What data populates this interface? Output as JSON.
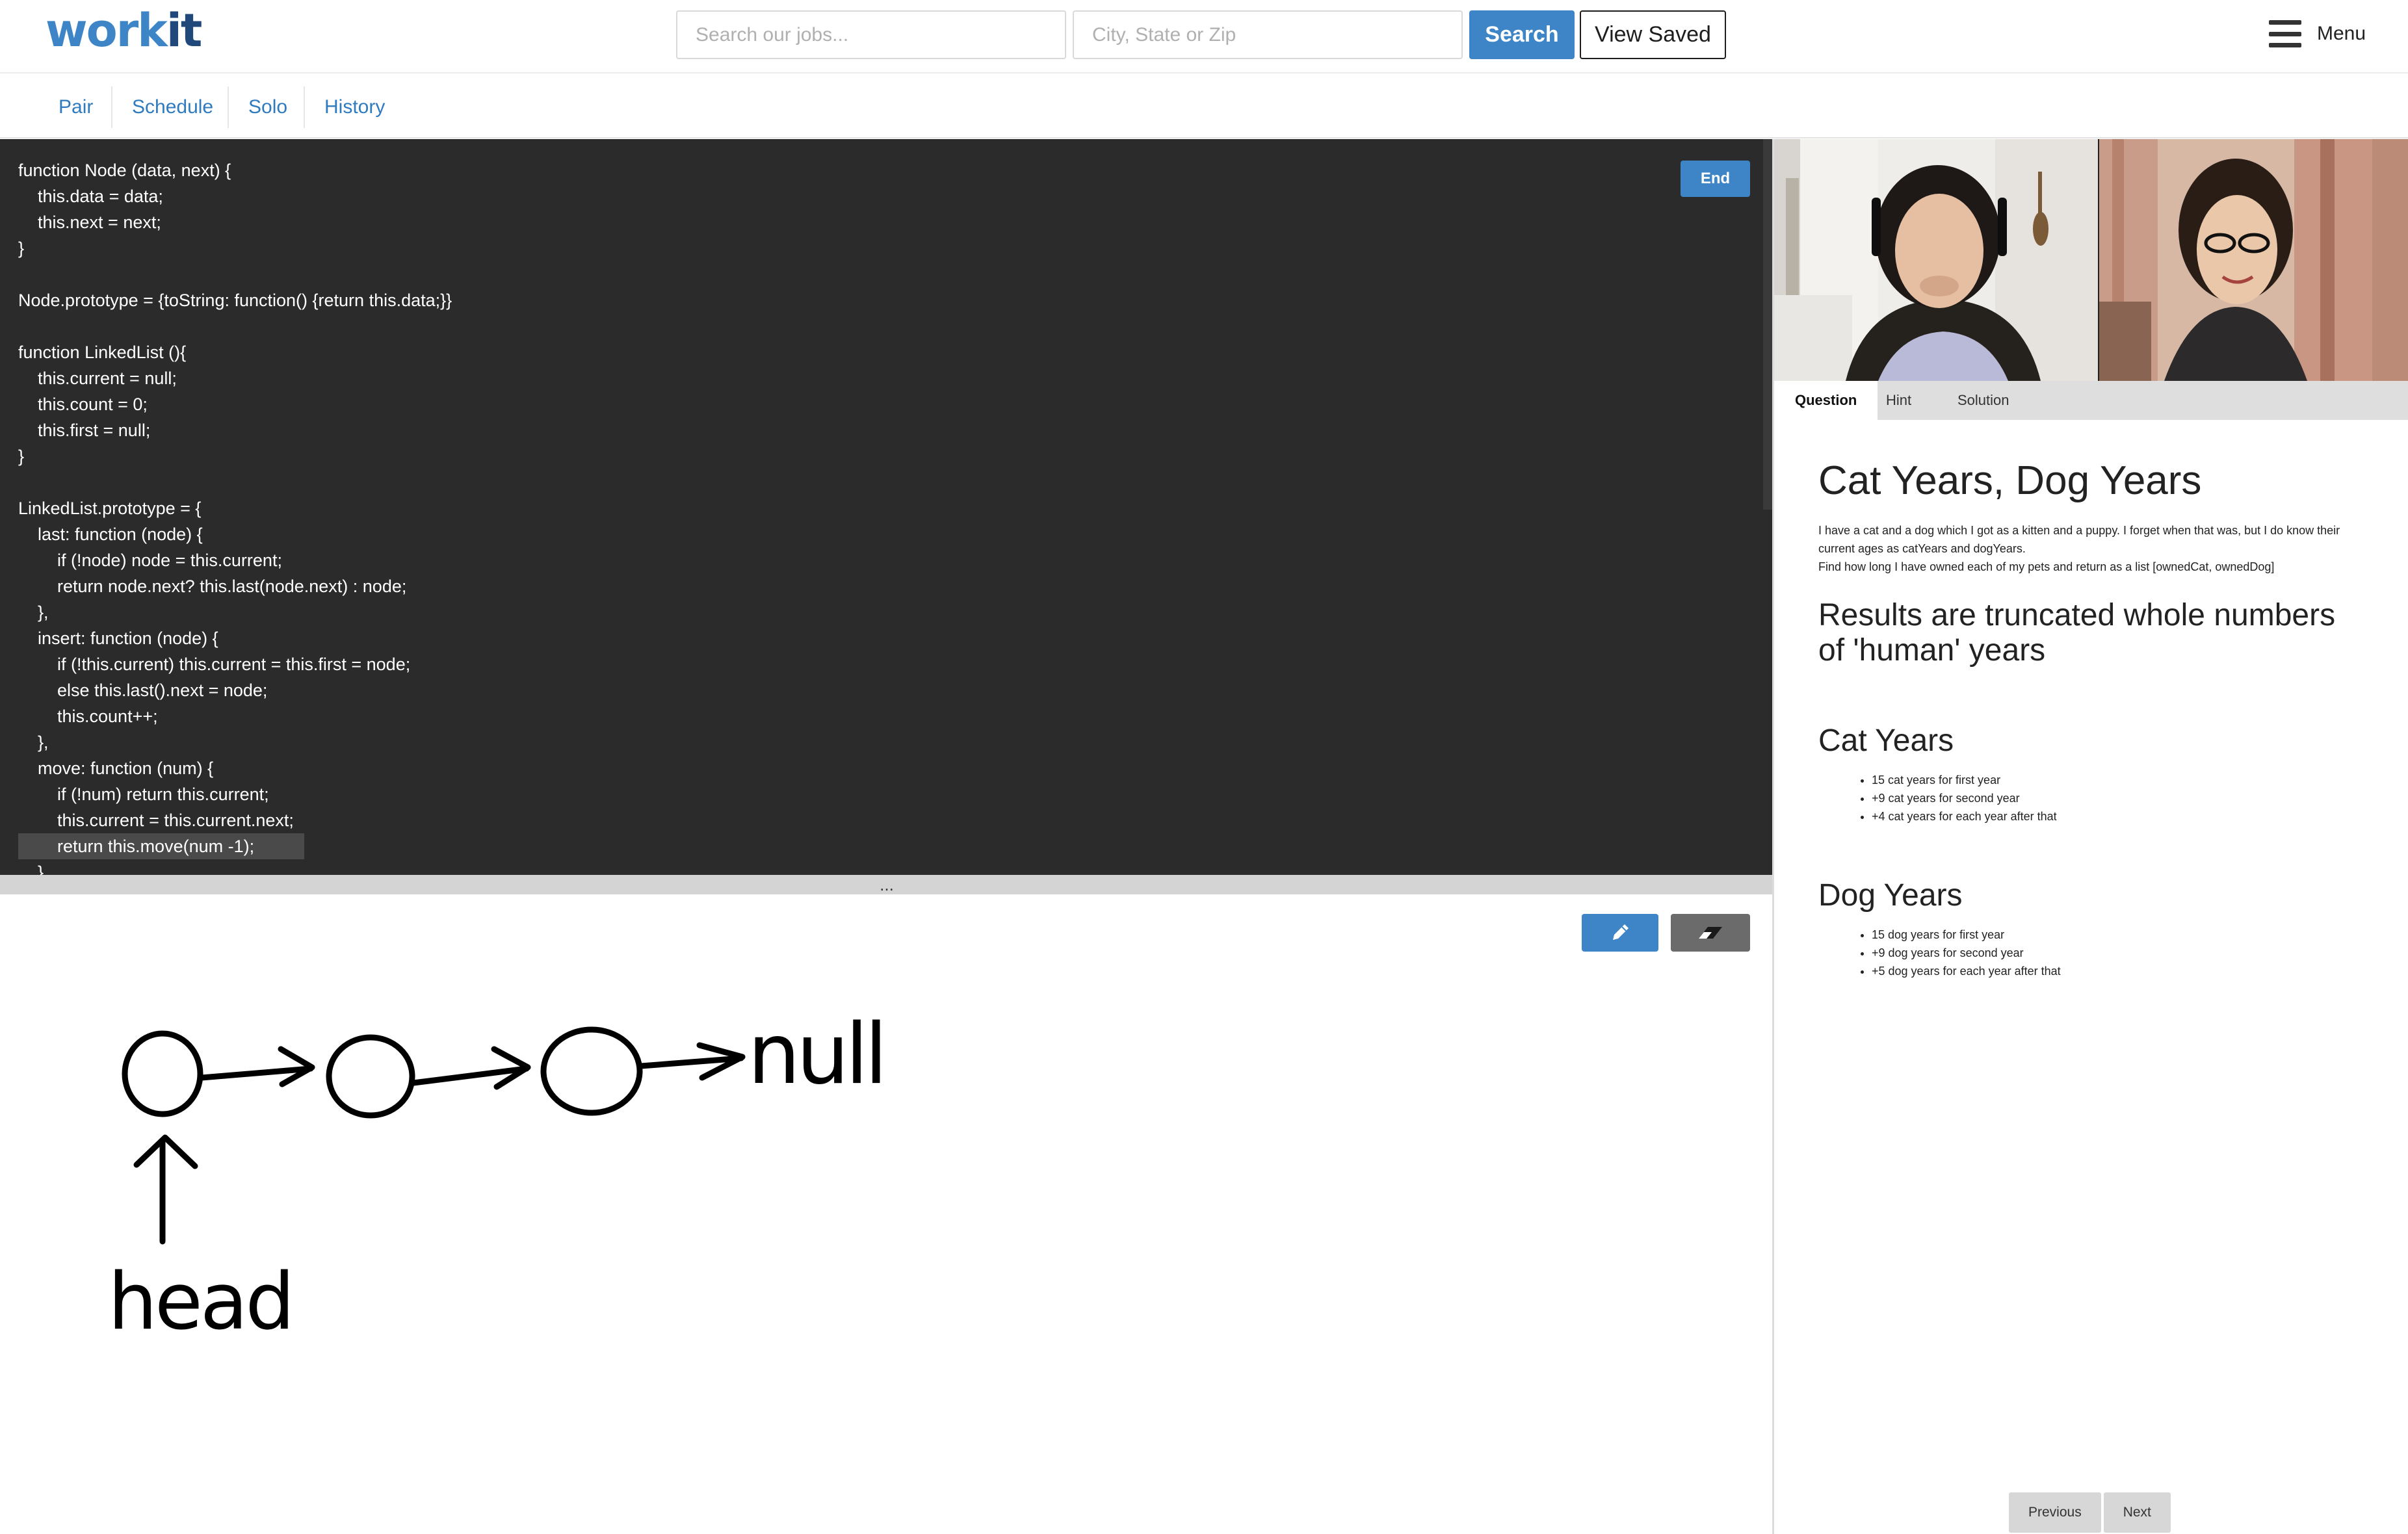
{
  "brand": {
    "logo_part1": "work",
    "logo_part2": "it",
    "accent_color": "#3d85c6"
  },
  "header": {
    "job_search_placeholder": "Search our jobs...",
    "location_placeholder": "City, State or Zip",
    "search_button": "Search",
    "saved_button": "View Saved",
    "menu_label": "Menu"
  },
  "subnav": {
    "items": [
      "Pair",
      "Schedule",
      "Solo",
      "History"
    ]
  },
  "editor": {
    "end_button": "End",
    "code_lines": [
      "function Node (data, next) {",
      "    this.data = data;",
      "    this.next = next;",
      "}",
      "",
      "Node.prototype = {toString: function() {return this.data;}}",
      "",
      "function LinkedList (){",
      "    this.current = null;",
      "    this.count = 0;",
      "    this.first = null;",
      "}",
      "",
      "LinkedList.prototype = {",
      "    last: function (node) {",
      "        if (!node) node = this.current;",
      "        return node.next? this.last(node.next) : node;",
      "    },",
      "    insert: function (node) {",
      "        if (!this.current) this.current = this.first = node;",
      "        else this.last().next = node;",
      "        this.count++;",
      "    },",
      "    move: function (num) {",
      "        if (!num) return this.current;",
      "        this.current = this.current.next;",
      "        return this.move(num -1);",
      "    }"
    ],
    "splitter_label": "..."
  },
  "whiteboard": {
    "pen_icon": "pencil-icon",
    "eraser_icon": "eraser-icon",
    "handwritten_labels": [
      "null",
      "head"
    ]
  },
  "question_panel": {
    "tabs": [
      "Question",
      "Hint",
      "Solution"
    ],
    "active_tab": "Question",
    "title": "Cat Years, Dog Years",
    "intro_1": "I have a cat and a dog which I got as a kitten and a puppy. I forget when that was, but I do know their current ages as catYears and dogYears.",
    "intro_2": "Find how long I have owned each of my pets and return as a list [ownedCat, ownedDog]",
    "subtitle": "Results are truncated whole numbers of 'human' years",
    "cat_heading": "Cat Years",
    "cat_rules": [
      "15 cat years for first year",
      "+9 cat years for second year",
      "+4 cat years for each year after that"
    ],
    "dog_heading": "Dog Years",
    "dog_rules": [
      "15 dog years for first year",
      "+9 dog years for second year",
      "+5 dog years for each year after that"
    ],
    "previous_button": "Previous",
    "next_button": "Next"
  }
}
